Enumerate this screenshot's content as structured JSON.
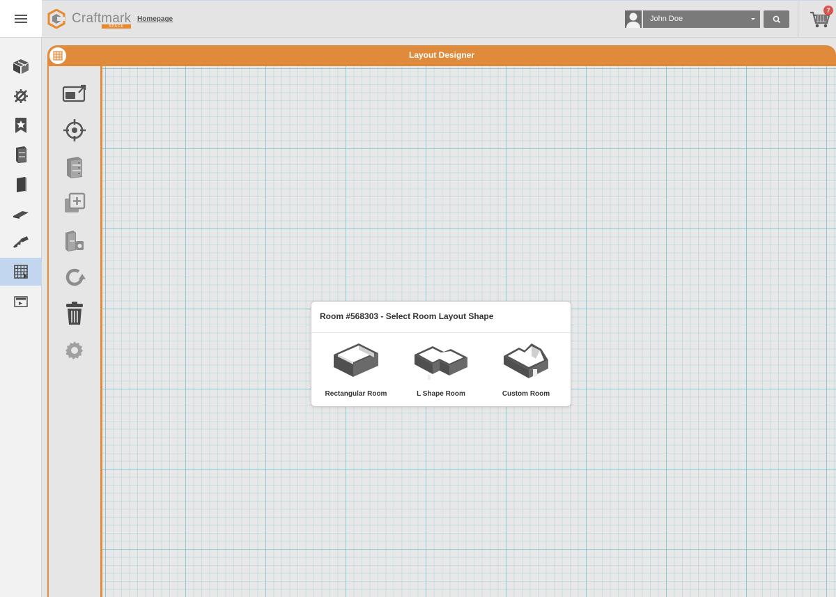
{
  "header": {
    "logo_text": "Craftmark",
    "logo_subtext": "SPACE",
    "homepage_link": "Homepage",
    "user_name": "John Doe",
    "cart_count": "7"
  },
  "rail": {
    "items": [
      {
        "icon": "box-icon"
      },
      {
        "icon": "tools-icon"
      },
      {
        "icon": "star-bookmark-icon"
      },
      {
        "icon": "cabinet-icon"
      },
      {
        "icon": "panel-icon"
      },
      {
        "icon": "countertop-icon"
      },
      {
        "icon": "hardware-icon"
      },
      {
        "icon": "layout-grid-icon",
        "active": true
      },
      {
        "icon": "bill-of-materials-icon"
      }
    ]
  },
  "designer": {
    "title": "Layout Designer",
    "tools": [
      {
        "icon": "resize-window-icon"
      },
      {
        "icon": "crosshair-icon"
      },
      {
        "icon": "cabinet-icon"
      },
      {
        "icon": "add-copy-icon"
      },
      {
        "icon": "appliance-icon"
      },
      {
        "icon": "rotate-icon"
      },
      {
        "icon": "trash-icon"
      },
      {
        "icon": "gear-icon"
      }
    ]
  },
  "modal": {
    "title": "Room #568303 - Select Room Layout Shape",
    "options": [
      {
        "label": "Rectangular Room",
        "icon": "rectangular-room-icon"
      },
      {
        "label": "L Shape Room",
        "icon": "l-shape-room-icon"
      },
      {
        "label": "Custom Room",
        "icon": "custom-room-icon"
      }
    ]
  },
  "colors": {
    "accent": "#e08a3c",
    "rail_active": "#c3d6ef",
    "grid_line": "#5ab9c8"
  }
}
